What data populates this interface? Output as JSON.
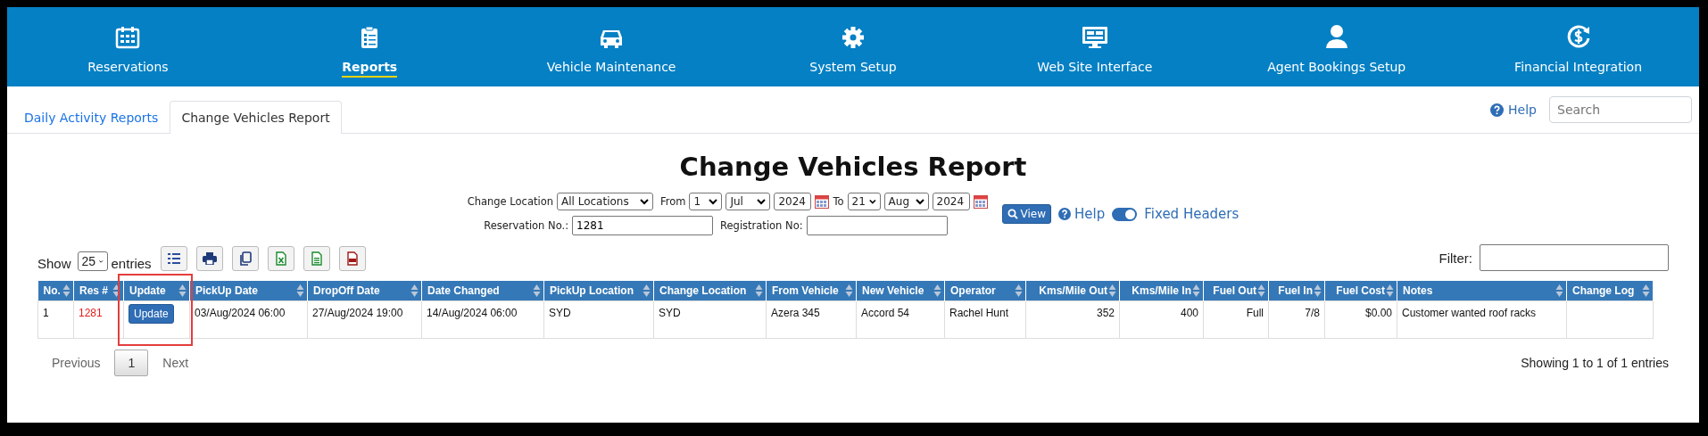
{
  "nav": {
    "items": [
      {
        "label": "Reservations",
        "selected": false
      },
      {
        "label": "Reports",
        "selected": true
      },
      {
        "label": "Vehicle Maintenance",
        "selected": false
      },
      {
        "label": "System Setup",
        "selected": false
      },
      {
        "label": "Web Site Interface",
        "selected": false
      },
      {
        "label": "Agent Bookings Setup",
        "selected": false
      },
      {
        "label": "Financial Integration",
        "selected": false
      }
    ]
  },
  "tabs": [
    {
      "label": "Daily Activity Reports",
      "selected": false
    },
    {
      "label": "Change Vehicles Report",
      "selected": true
    }
  ],
  "help_link": "Help",
  "search": {
    "placeholder": "Search"
  },
  "title": "Change Vehicles Report",
  "filters": {
    "change_location_label": "Change Location",
    "change_location": "All Locations",
    "from_label": "From",
    "from": [
      "1",
      "Jul",
      "2024"
    ],
    "to_label": "To",
    "to": [
      "21",
      "Aug",
      "2024"
    ],
    "view_button": "View",
    "help_link": "Help",
    "fixed_headers": {
      "label": "Fixed Headers",
      "on": true
    },
    "reservation_label": "Reservation No.:",
    "reservation_value": "1281",
    "registration_label": "Registration No:"
  },
  "table": {
    "show_label": "Show",
    "page_length": "25",
    "entries_label": "entries",
    "filter_label": "Filter:",
    "columns": [
      {
        "label": "No.",
        "highlighted": false
      },
      {
        "label": "Res #",
        "highlighted": false
      },
      {
        "label": "Update",
        "highlighted": true
      },
      {
        "label": "PickUp Date",
        "highlighted": false
      },
      {
        "label": "DropOff Date",
        "highlighted": false
      },
      {
        "label": "Date Changed",
        "highlighted": false
      },
      {
        "label": "PickUp Location",
        "highlighted": false
      },
      {
        "label": "Change Location",
        "highlighted": false
      },
      {
        "label": "From Vehicle",
        "highlighted": false
      },
      {
        "label": "New Vehicle",
        "highlighted": false
      },
      {
        "label": "Operator",
        "highlighted": false
      },
      {
        "label": "Kms/Mile Out",
        "highlighted": false
      },
      {
        "label": "Kms/Mile In",
        "highlighted": false
      },
      {
        "label": "Fuel Out",
        "highlighted": false
      },
      {
        "label": "Fuel In",
        "highlighted": false
      },
      {
        "label": "Fuel Cost",
        "highlighted": false
      },
      {
        "label": "Notes",
        "highlighted": false
      },
      {
        "label": "Change Log",
        "highlighted": false
      }
    ],
    "rows": [
      {
        "cells": [
          {
            "kind": "text",
            "text": "1"
          },
          {
            "kind": "link",
            "text": "1281"
          },
          {
            "kind": "button",
            "text": "Update"
          },
          {
            "kind": "text",
            "text": "03/Aug/2024 06:00"
          },
          {
            "kind": "text",
            "text": "27/Aug/2024 19:00"
          },
          {
            "kind": "text",
            "text": "14/Aug/2024 06:00"
          },
          {
            "kind": "text",
            "text": "SYD"
          },
          {
            "kind": "text",
            "text": "SYD"
          },
          {
            "kind": "text",
            "text": "Azera 345"
          },
          {
            "kind": "text",
            "text": "Accord 54"
          },
          {
            "kind": "text",
            "text": "Rachel Hunt"
          },
          {
            "kind": "text",
            "text": "352"
          },
          {
            "kind": "text",
            "text": "400"
          },
          {
            "kind": "text",
            "text": "Full"
          },
          {
            "kind": "text",
            "text": "7/8"
          },
          {
            "kind": "text",
            "text": "$0.00"
          },
          {
            "kind": "text",
            "text": "Customer wanted roof racks"
          },
          {
            "kind": "empty"
          }
        ]
      }
    ]
  },
  "pagination": {
    "previous": "Previous",
    "pages": [
      {
        "label": "1",
        "selected": true
      }
    ],
    "next": "Next",
    "info": "Showing 1 to 1 of 1 entries"
  }
}
